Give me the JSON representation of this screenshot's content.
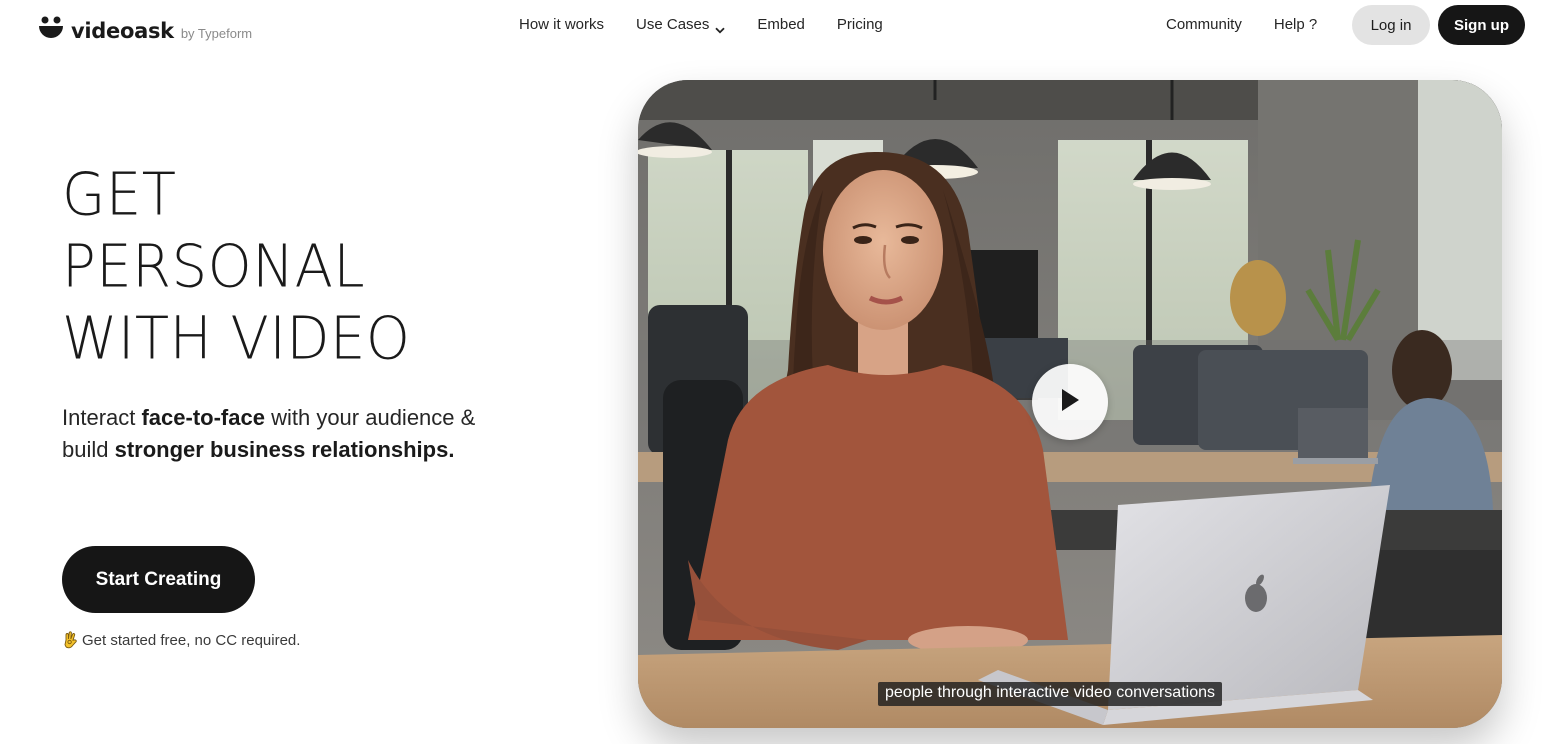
{
  "header": {
    "logo_text": "videoask",
    "logo_by": "by Typeform",
    "nav": {
      "how_it_works": "How it works",
      "use_cases": "Use Cases",
      "embed": "Embed",
      "pricing": "Pricing",
      "community": "Community",
      "help": "Help ?"
    },
    "login_label": "Log in",
    "signup_label": "Sign up"
  },
  "hero": {
    "headline_lines": [
      "GET",
      "PERSONAL",
      "WITH VIDEO"
    ],
    "subtext": {
      "p1": "Interact ",
      "b1": "face-to-face",
      "p2": " with your audience & build ",
      "b2": "stronger business relationships."
    },
    "cta_label": "Start Creating",
    "free_note": "Get started free, no CC required."
  },
  "video": {
    "caption": "people through interactive video conversations",
    "play_icon": "play-icon"
  },
  "colors": {
    "primary_dark": "#161616",
    "login_bg": "#e3e3e3",
    "sweater": "#a95a3f"
  }
}
